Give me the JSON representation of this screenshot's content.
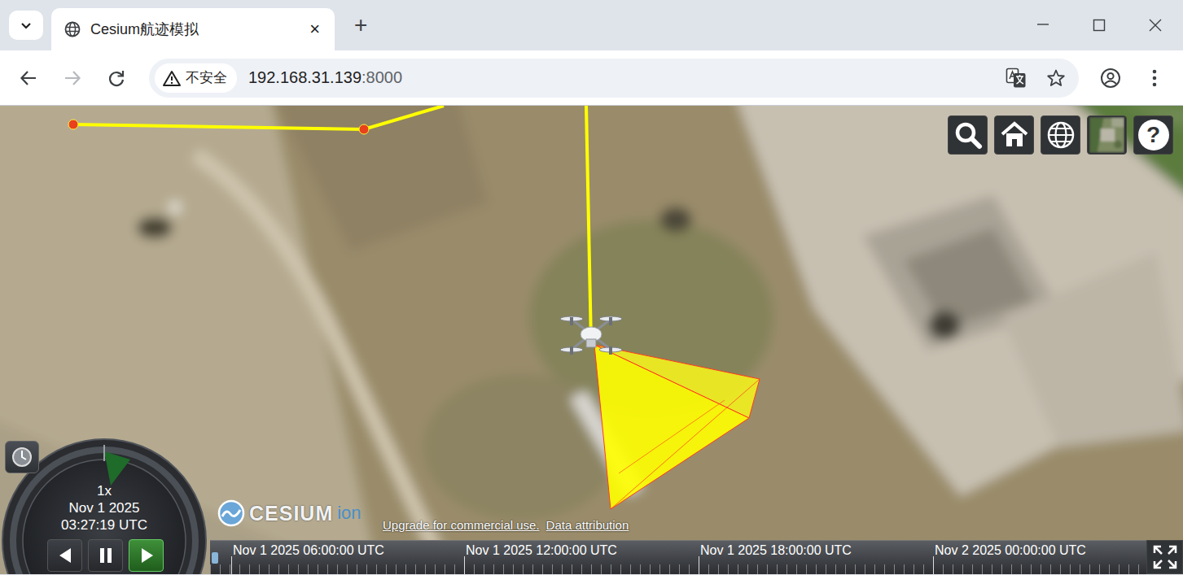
{
  "tabs": [
    {
      "label": "Cesium航迹模拟",
      "selected": true,
      "close": "×"
    }
  ],
  "new_tab": "+",
  "nav": {
    "back_disabled": false,
    "forward_disabled": true
  },
  "address": {
    "security": "不安全",
    "host": "192.168.31.139",
    "port": ":8000"
  },
  "viewer": {
    "toolbar": [
      {
        "kind": "search"
      },
      {
        "kind": "home"
      },
      {
        "kind": "scene-mode"
      },
      {
        "kind": "base-layer"
      },
      {
        "kind": "help",
        "label": "?"
      }
    ],
    "animation": {
      "speed": "1x",
      "date": "Nov 1 2025",
      "time": "03:27:19 UTC",
      "buttons": [
        {
          "kind": "reverse",
          "selected": false
        },
        {
          "kind": "pause",
          "selected": false
        },
        {
          "kind": "play",
          "selected": true
        }
      ]
    },
    "credits": {
      "logo": "CESIUM",
      "logo_suffix": "ion",
      "links": [
        "Upgrade for commercial use.",
        "Data attribution"
      ]
    },
    "timeline": {
      "labels": [
        "Nov 1 2025 06:00:00 UTC",
        "Nov 1 2025 12:00:00 UTC",
        "Nov 1 2025 18:00:00 UTC",
        "Nov 2 2025 00:00:00 UTC"
      ]
    }
  }
}
